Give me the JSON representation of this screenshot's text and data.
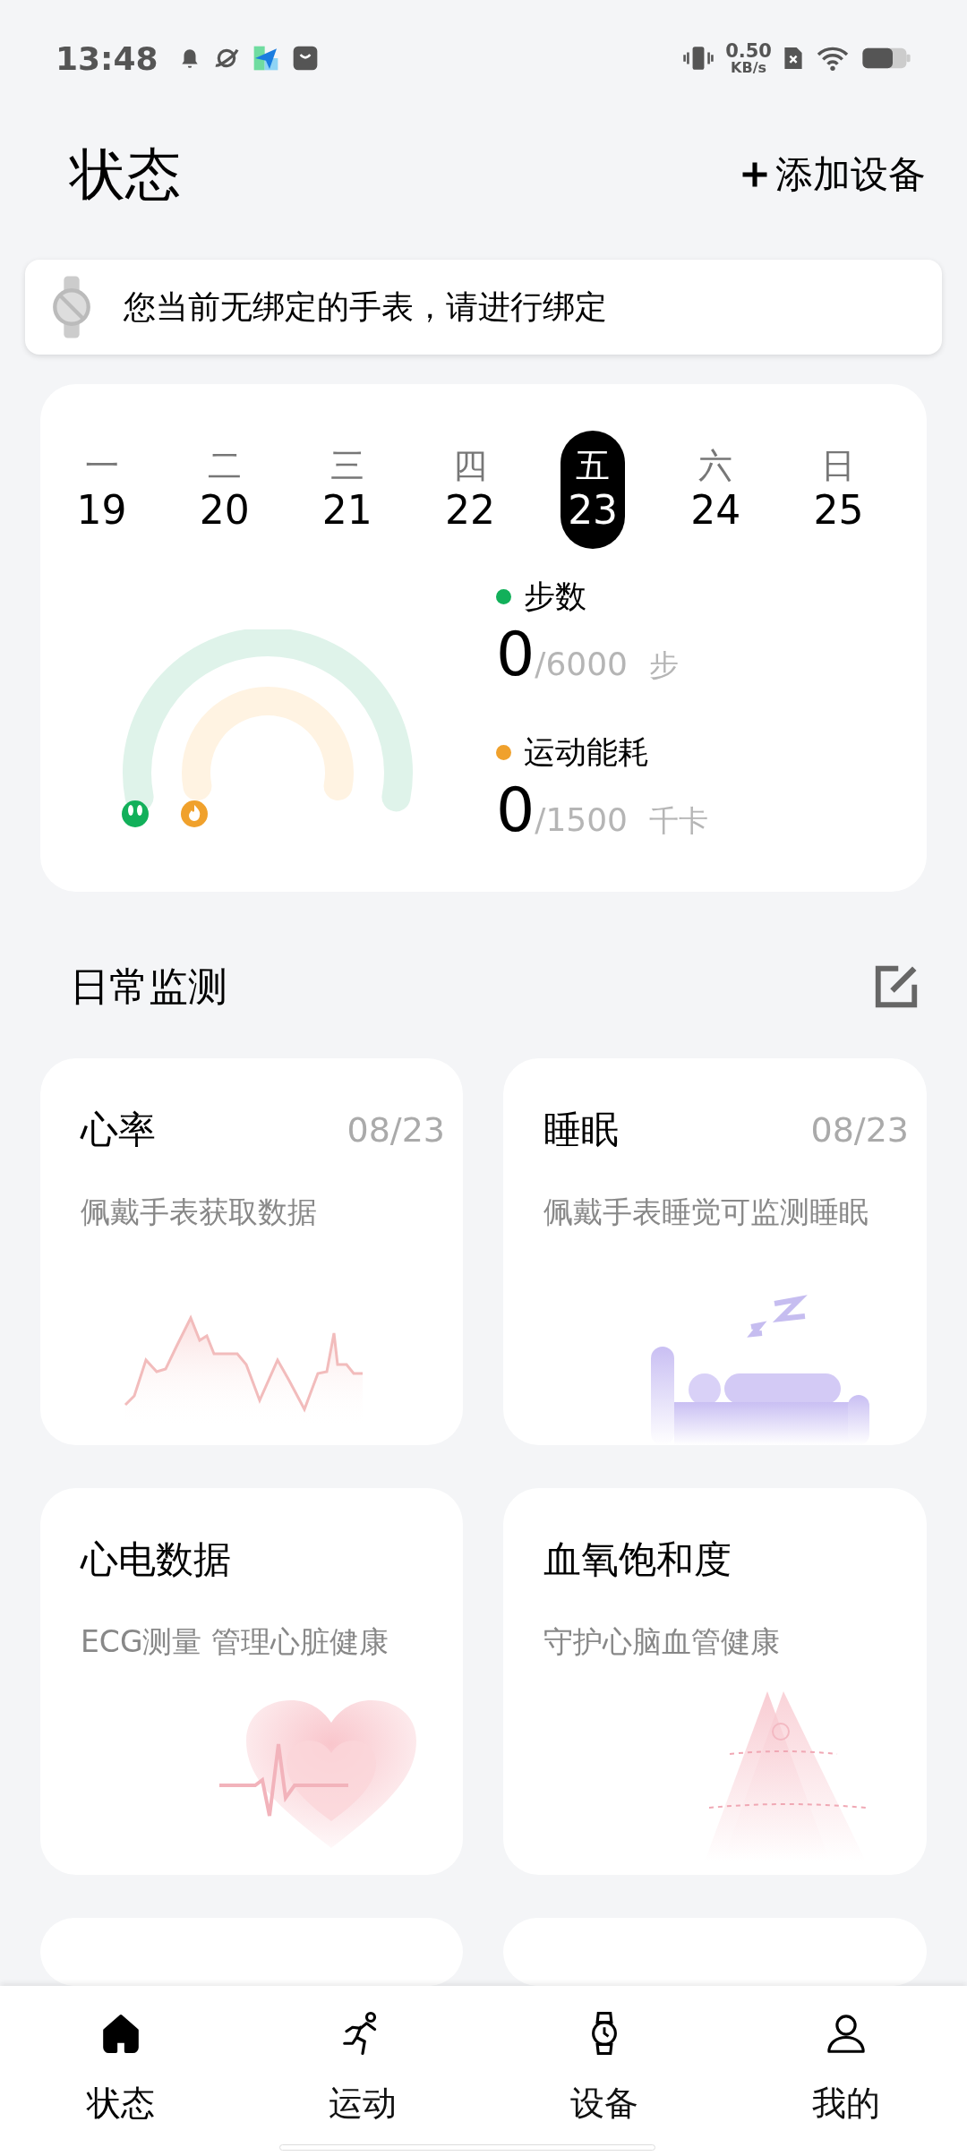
{
  "status_bar": {
    "time": "13:48",
    "net_speed_value": "0.50",
    "net_speed_unit": "KB/s"
  },
  "header": {
    "title": "状态",
    "add_device": "添加设备"
  },
  "notice": {
    "text": "您当前无绑定的手表，请进行绑定"
  },
  "week": [
    {
      "weekday": "一",
      "date": "19",
      "selected": false
    },
    {
      "weekday": "二",
      "date": "20",
      "selected": false
    },
    {
      "weekday": "三",
      "date": "21",
      "selected": false
    },
    {
      "weekday": "四",
      "date": "22",
      "selected": false
    },
    {
      "weekday": "五",
      "date": "23",
      "selected": true
    },
    {
      "weekday": "六",
      "date": "24",
      "selected": false
    },
    {
      "weekday": "日",
      "date": "25",
      "selected": false
    }
  ],
  "metrics": [
    {
      "label": "步数",
      "value": "0",
      "target": "/6000",
      "unit": "步",
      "color": "#12b05a"
    },
    {
      "label": "运动能耗",
      "value": "0",
      "target": "/1500",
      "unit": "千卡",
      "color": "#f0a12c"
    }
  ],
  "monitor": {
    "title": "日常监测",
    "cards": [
      {
        "kind": "heart_rate",
        "title": "心率",
        "date": "08/23",
        "description": "佩戴手表获取数据"
      },
      {
        "kind": "sleep",
        "title": "睡眠",
        "date": "08/23",
        "description": "佩戴手表睡觉可监测睡眠"
      },
      {
        "kind": "ecg",
        "title": "心电数据",
        "description": "ECG测量 管理心脏健康"
      },
      {
        "kind": "spo2",
        "title": "血氧饱和度",
        "description": "守护心脑血管健康"
      },
      {
        "kind": "partial"
      },
      {
        "kind": "partial"
      }
    ]
  },
  "nav": [
    {
      "label": "状态",
      "selected": true
    },
    {
      "label": "运动",
      "selected": false
    },
    {
      "label": "设备",
      "selected": false
    },
    {
      "label": "我的",
      "selected": false
    }
  ]
}
